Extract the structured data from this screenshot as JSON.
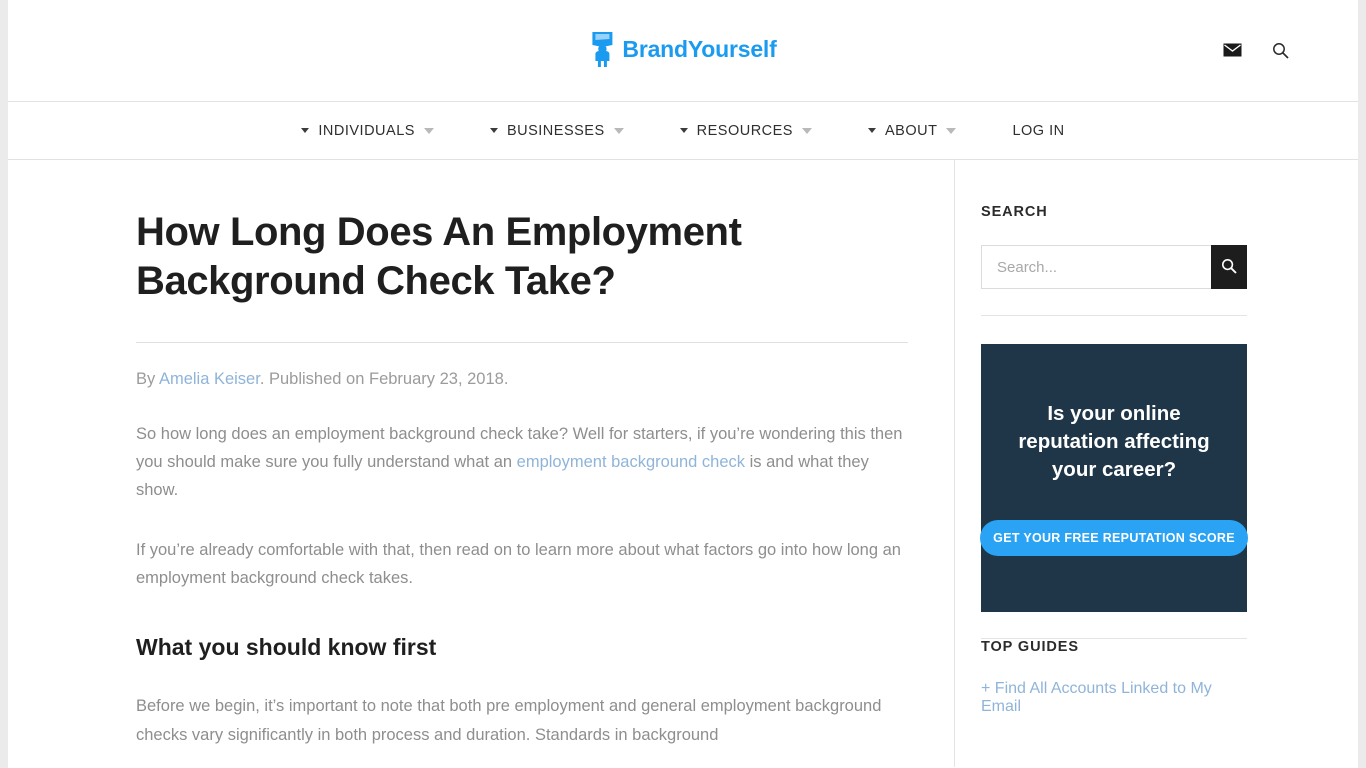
{
  "header": {
    "logo_text": "BrandYourself",
    "logo_icon": "brandyourself-mark-icon",
    "mail_icon": "mail-icon",
    "search_icon": "search-icon"
  },
  "nav": {
    "items": [
      {
        "label": "INDIVIDUALS",
        "has_dropdown": true
      },
      {
        "label": "BUSINESSES",
        "has_dropdown": true
      },
      {
        "label": "RESOURCES",
        "has_dropdown": true
      },
      {
        "label": "ABOUT",
        "has_dropdown": true
      },
      {
        "label": "LOG IN",
        "has_dropdown": false
      }
    ]
  },
  "article": {
    "title": "How Long Does An Employment Background Check Take?",
    "byline": {
      "prefix": "By ",
      "author": "Amelia Keiser",
      "suffix": ". Published on February 23, 2018."
    },
    "paragraph1": {
      "part1": "So how long does an employment background check take? Well for starters, if you’re wondering this then you should make sure you fully understand what an ",
      "link": "employment background check",
      "part2": " is and what they show."
    },
    "paragraph2": "If you’re already comfortable with that, then read on to learn more about what factors go into how long an employment background check takes.",
    "subheading": "What you should know first",
    "paragraph3": "Before we begin, it’s important to note that both pre employment and general employment background checks vary significantly in both process and duration. Standards in background"
  },
  "sidebar": {
    "search": {
      "heading": "SEARCH",
      "placeholder": "Search...",
      "value": "",
      "button_icon": "search-icon"
    },
    "promo": {
      "headline": "Is your online reputation affecting your career?",
      "cta_label": "GET YOUR FREE REPUTATION SCORE",
      "background_color": "#1f3648",
      "cta_color": "#2aa3f4"
    },
    "top_guides": {
      "heading": "TOP GUIDES",
      "links": [
        "+ Find All Accounts Linked to My Email"
      ]
    }
  },
  "colors": {
    "brand_blue": "#1b9bf0",
    "link_blue": "#8fb4d9",
    "body_text": "#8e8e8e",
    "heading_text": "#1f1f1f"
  }
}
